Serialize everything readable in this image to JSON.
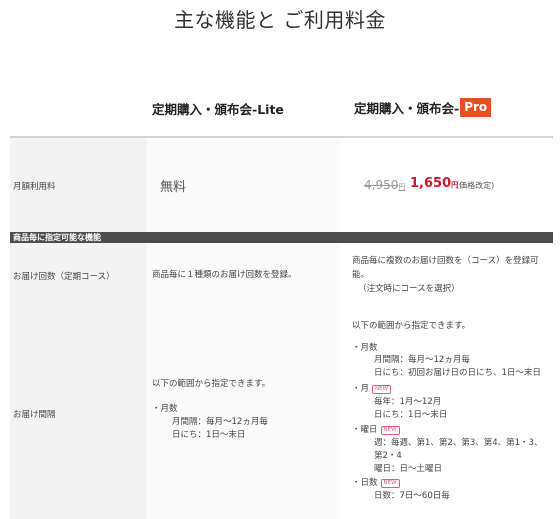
{
  "page": {
    "title": "主な機能と ご利用料金"
  },
  "plans": {
    "lite": {
      "name": "定期購入・頒布会-Lite"
    },
    "pro": {
      "name": "定期購入・頒布会-",
      "badge": "Pro"
    }
  },
  "rows": {
    "monthly": {
      "label": "月額利用料",
      "lite_value": "無料",
      "pro_old_price": "4,950",
      "pro_old_unit": "円",
      "pro_new_price": "1,650",
      "pro_new_unit": "円",
      "pro_note": "(価格改定)"
    },
    "section": {
      "label": "商品毎に指定可能な機能"
    },
    "course": {
      "label": "お届け回数（定期コース）",
      "lite_text": "商品毎に１種類のお届け回数を登録。",
      "pro_lines": [
        "商品毎に複数のお届け回数を（コース）を登録可",
        "能。",
        "（注文時にコースを選択）"
      ]
    },
    "interval": {
      "label": "お届け間隔",
      "lite_lines": [
        "以下の範囲から指定できます。",
        "・月数",
        "月間隔：毎月～12ヵ月毎",
        "日にち：1日～末日"
      ],
      "pro_intro": "以下の範囲から指定できます。",
      "pro_month_head": "・月数",
      "pro_month_lines": [
        "月間隔：毎月～12ヵ月毎",
        "日にち：初回お届け日の日にち、1日～末日"
      ],
      "pro_day_head": "・月",
      "pro_day_lines": [
        "毎年：1月～12月",
        "日にち：1日～末日"
      ],
      "pro_week_head": "・曜日",
      "pro_week_lines": [
        "週：毎週、第1、第2、第3、第4、第1・3、",
        "第2・4",
        "曜日：日～土曜日"
      ],
      "pro_days_head": "・日数",
      "pro_days_lines": [
        "日数：7日～60日毎"
      ],
      "new_badge": "NEW"
    }
  }
}
